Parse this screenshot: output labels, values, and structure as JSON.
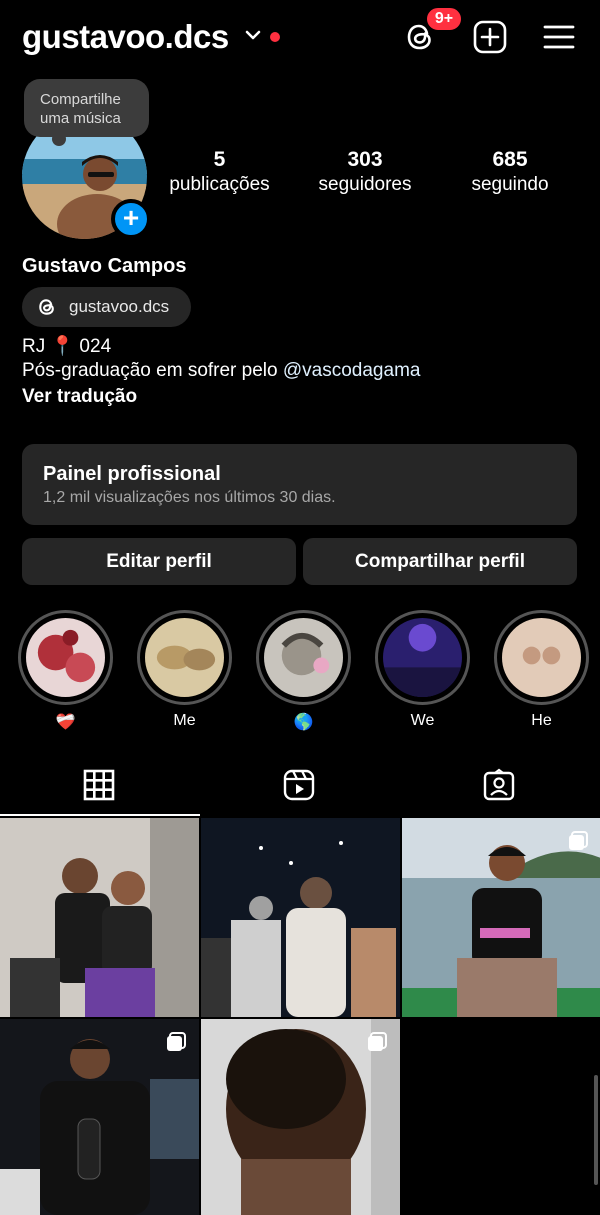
{
  "header": {
    "username": "gustavoo.dcs",
    "notif_badge": "9+",
    "icons": [
      "chevron-down-icon",
      "threads-icon",
      "create-plus-icon",
      "menu-icon"
    ]
  },
  "profile": {
    "note": "Compartilhe uma música",
    "stats": [
      {
        "num": "5",
        "label": "publicações"
      },
      {
        "num": "303",
        "label": "seguidores"
      },
      {
        "num": "685",
        "label": "seguindo"
      }
    ],
    "full_name": "Gustavo Campos",
    "threads_handle": "gustavoo.dcs",
    "bio_line1": "RJ 📍 024",
    "bio_line2_prefix": "Pós-graduação em sofrer pelo ",
    "bio_mention": "@vascodagama",
    "translate": "Ver tradução"
  },
  "dashboard": {
    "title": "Painel profissional",
    "subtitle": "1,2 mil visualizações nos últimos 30 dias."
  },
  "buttons": {
    "edit": "Editar perfil",
    "share": "Compartilhar perfil"
  },
  "highlights": [
    {
      "label": "❤️‍🩹"
    },
    {
      "label": "Me"
    },
    {
      "label": "🌎"
    },
    {
      "label": "We"
    },
    {
      "label": "He"
    }
  ],
  "tabs": [
    "grid-icon",
    "reels-icon",
    "tagged-icon"
  ],
  "colors": {
    "accent_blue": "#0095f6",
    "notification_red": "#ff3040",
    "surface": "#262626"
  }
}
